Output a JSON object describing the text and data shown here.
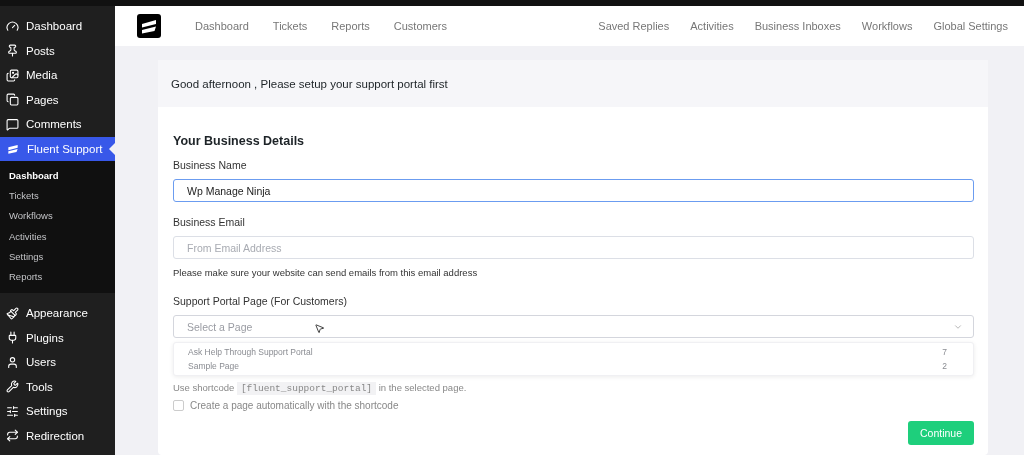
{
  "sidebar": {
    "items": [
      {
        "label": "Dashboard",
        "selected": false
      },
      {
        "label": "Posts",
        "selected": false
      },
      {
        "label": "Media",
        "selected": false
      },
      {
        "label": "Pages",
        "selected": false
      },
      {
        "label": "Comments",
        "selected": false
      },
      {
        "label": "Fluent Support",
        "selected": true,
        "children": [
          {
            "label": "Dashboard",
            "selected": true
          },
          {
            "label": "Tickets",
            "selected": false
          },
          {
            "label": "Workflows",
            "selected": false
          },
          {
            "label": "Activities",
            "selected": false
          },
          {
            "label": "Settings",
            "selected": false
          },
          {
            "label": "Reports",
            "selected": false
          }
        ]
      },
      {
        "label": "Appearance",
        "selected": false
      },
      {
        "label": "Plugins",
        "selected": false
      },
      {
        "label": "Users",
        "selected": false
      },
      {
        "label": "Tools",
        "selected": false
      },
      {
        "label": "Settings",
        "selected": false
      },
      {
        "label": "Redirection",
        "selected": false
      }
    ]
  },
  "nav": {
    "left": [
      "Dashboard",
      "Tickets",
      "Reports",
      "Customers"
    ],
    "right": [
      "Saved Replies",
      "Activities",
      "Business Inboxes",
      "Workflows",
      "Global Settings"
    ]
  },
  "card": {
    "title": "Good afternoon , Please setup your support portal first",
    "section_title": "Your Business Details",
    "fields": [
      {
        "label": "Business Name",
        "value": "Wp Manage Ninja",
        "focused": true
      },
      {
        "label": "Business Email",
        "placeholder": "From Email Address",
        "focused": false
      }
    ],
    "email_note": "Please make sure your website can send emails from this email address",
    "portal": {
      "label": "Support Portal Page (For Customers)",
      "placeholder": "Select a Page",
      "options": [
        {
          "label": "Ask Help Through Support Portal",
          "id": "7"
        },
        {
          "label": "Sample Page",
          "id": "2"
        }
      ],
      "help_before": "Use shortcode",
      "shortcode": "[fluent_support_portal]",
      "help_after": "in the selected page.",
      "auto_create": {
        "label": "Create a page automatically with the shortcode",
        "checked": false
      }
    },
    "button": "Continue"
  }
}
